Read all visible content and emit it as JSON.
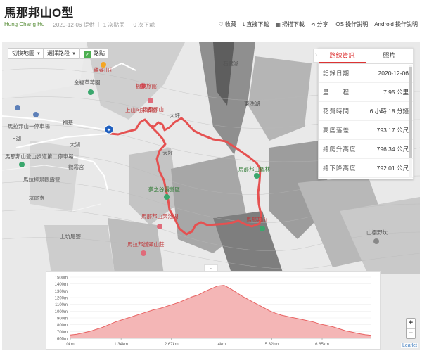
{
  "page": {
    "title": "馬那邦山O型",
    "author": "Hung Chang Hu",
    "date": "2020-12-06 提供",
    "clicks": "1 次點閱",
    "downloads": "0 次下載"
  },
  "actions": [
    {
      "icon": "heart-icon",
      "glyph": "♡",
      "label": "收藏"
    },
    {
      "icon": "download-icon",
      "glyph": "⤓",
      "label": "直接下載"
    },
    {
      "icon": "qr-code-icon",
      "glyph": "▦",
      "label": "掃描下載"
    },
    {
      "icon": "share-icon",
      "glyph": "⋖",
      "label": "分享"
    },
    {
      "icon": "ios-help",
      "glyph": "",
      "label": "iOS 操作說明"
    },
    {
      "icon": "android-help",
      "glyph": "",
      "label": "Android 操作說明"
    }
  ],
  "map_controls": {
    "switch_map": "切換地圖",
    "select_route": "選擇路段",
    "route_toggle": "路點"
  },
  "panel": {
    "tab_record": "路線資訊",
    "tab_photos": "照片",
    "rows": [
      {
        "k": "記錄日期",
        "v": "2020-12-06"
      },
      {
        "k": "里　　程",
        "v": "7.95 公里"
      },
      {
        "k": "花費時間",
        "v": "6 小時 18 分鐘"
      },
      {
        "k": "高度落差",
        "v": "793.17 公尺"
      },
      {
        "k": "總爬升高度",
        "v": "796.34 公尺"
      },
      {
        "k": "總下降高度",
        "v": "792.01 公尺"
      }
    ]
  },
  "map_labels": [
    {
      "text": "雞姿山莊",
      "style": "red"
    },
    {
      "text": "金福草莓園",
      "style": ""
    },
    {
      "text": "楓葉旅館",
      "style": "red"
    },
    {
      "text": "上山阿家餐廳",
      "style": "red"
    },
    {
      "text": "馬拉邦山一停車場",
      "style": ""
    },
    {
      "text": "馬那邦山登山步道第二停車場",
      "style": ""
    },
    {
      "text": "馬拉棒景觀露營",
      "style": ""
    },
    {
      "text": "夢之谷露營區",
      "style": "green"
    },
    {
      "text": "馬那邦山天池湖",
      "style": "red"
    },
    {
      "text": "馬拉邦護頭山莊",
      "style": "red"
    },
    {
      "text": "馬那邦山楓林",
      "style": "green"
    },
    {
      "text": "馬那邦山",
      "style": "red"
    },
    {
      "text": "馬那邦山",
      "style": "red"
    },
    {
      "text": "山櫻野炊",
      "style": ""
    },
    {
      "text": "上坑尾寮",
      "style": ""
    },
    {
      "text": "坑尾寮",
      "style": ""
    },
    {
      "text": "福基",
      "style": ""
    },
    {
      "text": "上湖",
      "style": ""
    },
    {
      "text": "大湖",
      "style": ""
    },
    {
      "text": "觀霧宮",
      "style": ""
    },
    {
      "text": "東洗湖",
      "style": ""
    },
    {
      "text": "石壁湖",
      "style": ""
    },
    {
      "text": "大坪",
      "style": ""
    },
    {
      "text": "大坪",
      "style": ""
    }
  ],
  "elevation": {
    "y_ticks": [
      "1500m",
      "1400m",
      "1300m",
      "1200m",
      "1100m",
      "1000m",
      "900m",
      "800m",
      "700m",
      "600m"
    ],
    "x_ticks": [
      "0km",
      "1.34km",
      "2.67km",
      "4km",
      "5.32km",
      "6.65km"
    ],
    "profile": [
      650,
      660,
      680,
      700,
      730,
      760,
      800,
      840,
      870,
      900,
      930,
      960,
      990,
      1020,
      1040,
      1070,
      1100,
      1130,
      1170,
      1210,
      1240,
      1290,
      1330,
      1370,
      1380,
      1330,
      1270,
      1210,
      1160,
      1110,
      1060,
      1010,
      970,
      940,
      920,
      900,
      880,
      860,
      840,
      810,
      790,
      770,
      740,
      710,
      690,
      670,
      655,
      645
    ],
    "y_min": 600,
    "y_max": 1500,
    "fill_color": "#f4b6b6",
    "line_color": "#e86262"
  },
  "zoom": {
    "plus": "+",
    "minus": "−"
  },
  "attribution": "Leaflet"
}
